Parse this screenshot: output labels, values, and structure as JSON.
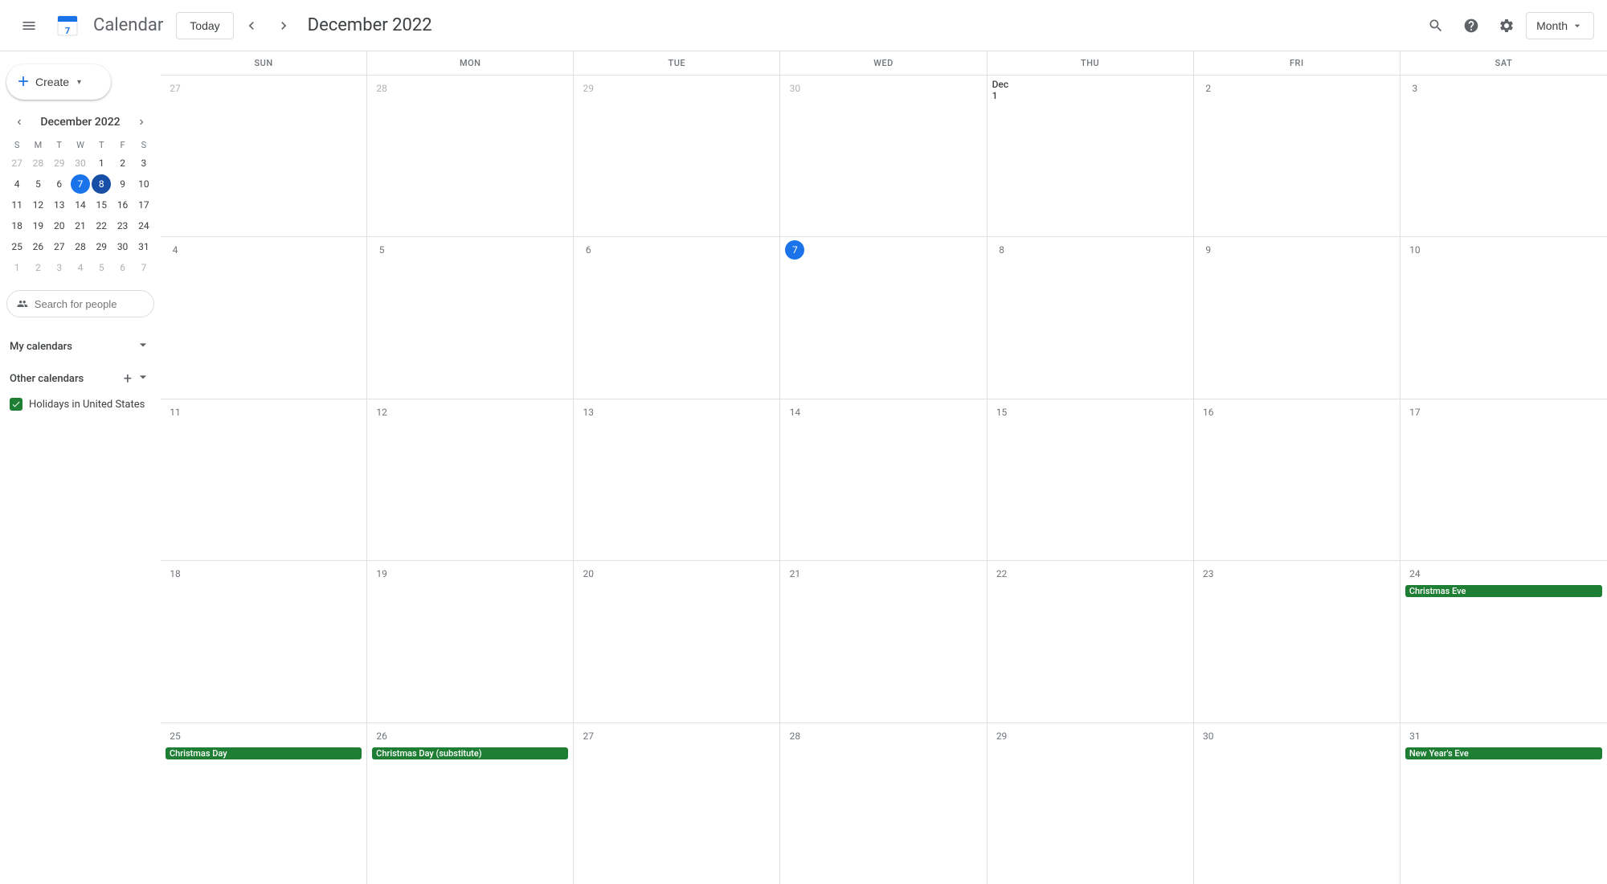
{
  "app": {
    "name": "Calendar",
    "logo_colors": [
      "#4285F4",
      "#34A853",
      "#FBBC05",
      "#EA4335"
    ]
  },
  "topbar": {
    "hamburger_label": "Menu",
    "today_label": "Today",
    "prev_label": "Previous",
    "next_label": "Next",
    "current_month": "December 2022",
    "search_label": "Search",
    "help_label": "Help",
    "settings_label": "Settings",
    "view_mode": "Month",
    "view_dropdown_label": "Month"
  },
  "sidebar": {
    "create_label": "Create",
    "mini_calendar": {
      "title": "December 2022",
      "dow_labels": [
        "S",
        "M",
        "T",
        "W",
        "T",
        "F",
        "S"
      ],
      "weeks": [
        [
          {
            "day": 27,
            "other": true
          },
          {
            "day": 28,
            "other": true
          },
          {
            "day": 29,
            "other": true
          },
          {
            "day": 30,
            "other": true
          },
          {
            "day": 1,
            "other": false
          },
          {
            "day": 2,
            "other": false
          },
          {
            "day": 3,
            "other": false
          }
        ],
        [
          {
            "day": 4,
            "other": false
          },
          {
            "day": 5,
            "other": false
          },
          {
            "day": 6,
            "other": false
          },
          {
            "day": 7,
            "other": false,
            "today": true
          },
          {
            "day": 8,
            "other": false,
            "selected": true
          },
          {
            "day": 9,
            "other": false
          },
          {
            "day": 10,
            "other": false
          }
        ],
        [
          {
            "day": 11,
            "other": false
          },
          {
            "day": 12,
            "other": false
          },
          {
            "day": 13,
            "other": false
          },
          {
            "day": 14,
            "other": false
          },
          {
            "day": 15,
            "other": false
          },
          {
            "day": 16,
            "other": false
          },
          {
            "day": 17,
            "other": false
          }
        ],
        [
          {
            "day": 18,
            "other": false
          },
          {
            "day": 19,
            "other": false
          },
          {
            "day": 20,
            "other": false
          },
          {
            "day": 21,
            "other": false
          },
          {
            "day": 22,
            "other": false
          },
          {
            "day": 23,
            "other": false
          },
          {
            "day": 24,
            "other": false
          }
        ],
        [
          {
            "day": 25,
            "other": false
          },
          {
            "day": 26,
            "other": false
          },
          {
            "day": 27,
            "other": false
          },
          {
            "day": 28,
            "other": false
          },
          {
            "day": 29,
            "other": false
          },
          {
            "day": 30,
            "other": false
          },
          {
            "day": 31,
            "other": false
          }
        ],
        [
          {
            "day": 1,
            "other": true
          },
          {
            "day": 2,
            "other": true
          },
          {
            "day": 3,
            "other": true
          },
          {
            "day": 4,
            "other": true
          },
          {
            "day": 5,
            "other": true
          },
          {
            "day": 6,
            "other": true
          },
          {
            "day": 7,
            "other": true
          }
        ]
      ]
    },
    "people_search_placeholder": "Search for people",
    "my_calendars_label": "My calendars",
    "other_calendars_label": "Other calendars",
    "other_calendars": [
      {
        "name": "Holidays in United States",
        "color": "#1e7e34",
        "checked": true
      }
    ]
  },
  "calendar": {
    "dow_headers": [
      "SUN",
      "MON",
      "TUE",
      "WED",
      "THU",
      "FRI",
      "SAT"
    ],
    "weeks": [
      {
        "days": [
          {
            "num": "27",
            "other": true
          },
          {
            "num": "28",
            "other": true
          },
          {
            "num": "29",
            "other": true
          },
          {
            "num": "30",
            "other": true
          },
          {
            "num": "Dec 1",
            "first": true
          },
          {
            "num": "2",
            "other": false
          },
          {
            "num": "3",
            "other": false
          }
        ],
        "events": []
      },
      {
        "days": [
          {
            "num": "4"
          },
          {
            "num": "5"
          },
          {
            "num": "6"
          },
          {
            "num": "7",
            "today": true
          },
          {
            "num": "8"
          },
          {
            "num": "9"
          },
          {
            "num": "10"
          }
        ],
        "events": []
      },
      {
        "days": [
          {
            "num": "11"
          },
          {
            "num": "12"
          },
          {
            "num": "13"
          },
          {
            "num": "14"
          },
          {
            "num": "15"
          },
          {
            "num": "16"
          },
          {
            "num": "17"
          }
        ],
        "events": []
      },
      {
        "days": [
          {
            "num": "18"
          },
          {
            "num": "19"
          },
          {
            "num": "20"
          },
          {
            "num": "21"
          },
          {
            "num": "22"
          },
          {
            "num": "23"
          },
          {
            "num": "24"
          }
        ],
        "events": [
          {
            "col": 6,
            "label": "Christmas Eve",
            "color": "#1e7e34",
            "span": 1
          }
        ]
      },
      {
        "days": [
          {
            "num": "25"
          },
          {
            "num": "26"
          },
          {
            "num": "27"
          },
          {
            "num": "28"
          },
          {
            "num": "29"
          },
          {
            "num": "30"
          },
          {
            "num": "31"
          }
        ],
        "events": [
          {
            "col": 0,
            "label": "Christmas Day",
            "color": "#1e7e34",
            "span": 1
          },
          {
            "col": 1,
            "label": "Christmas Day (substitute)",
            "color": "#1e7e34",
            "span": 1
          },
          {
            "col": 6,
            "label": "New Year's Eve",
            "color": "#1e7e34",
            "span": 1
          }
        ]
      }
    ]
  }
}
